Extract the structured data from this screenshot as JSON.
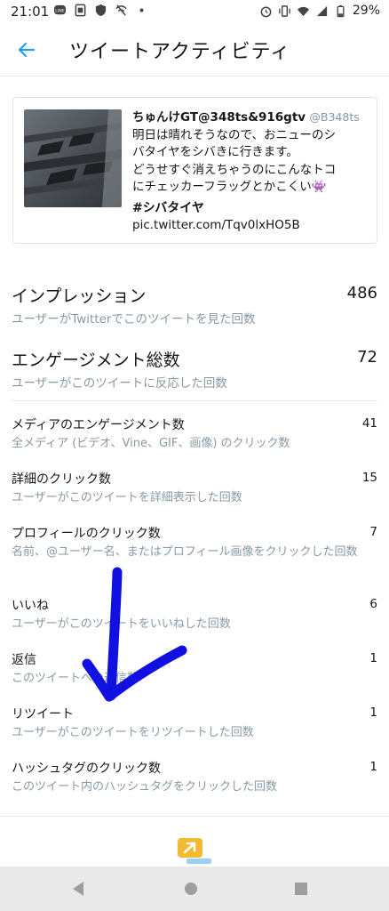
{
  "status_bar": {
    "time": "21:01",
    "battery": "29%"
  },
  "header": {
    "title": "ツイートアクティビティ"
  },
  "tweet": {
    "author": "ちゅんけGT@348ts&916gtv",
    "handle": "@B348ts",
    "text_line1": "明日は晴れそうなので、おニューのシ",
    "text_line2": "バタイヤをシバきに行きます。",
    "text_line3": "どうせすぐ消えちゃうのにこんなトコ",
    "text_line4": "にチェッカーフラッグとかこくい",
    "emoji": "👾",
    "hashtag": "#シバタイヤ",
    "link": "pic.twitter.com/Tqv0lxHO5B"
  },
  "metrics": [
    {
      "label": "インプレッション",
      "value": "486",
      "desc": "ユーザーがTwitterでこのツイートを見た回数"
    },
    {
      "label": "エンゲージメント総数",
      "value": "72",
      "desc": "ユーザーがこのツイートに反応した回数"
    },
    {
      "label": "メディアのエンゲージメント数",
      "value": "41",
      "desc": "全メディア (ビデオ、Vine、GIF、画像) のクリック数"
    },
    {
      "label": "詳細のクリック数",
      "value": "15",
      "desc": "ユーザーがこのツイートを詳細表示した回数"
    },
    {
      "label": "プロフィールのクリック数",
      "value": "7",
      "desc": "名前、@ユーザー名、またはプロフィール画像をクリックした回数"
    },
    {
      "label": "いいね",
      "value": "6",
      "desc": "ユーザーがこのツイートをいいねした回数"
    },
    {
      "label": "返信",
      "value": "1",
      "desc": "このツイートへの返信数"
    },
    {
      "label": "リツイート",
      "value": "1",
      "desc": "ユーザーがこのツイートをリツイートした回数"
    },
    {
      "label": "ハッシュタグのクリック数",
      "value": "1",
      "desc": "このツイート内のハッシュタグをクリックした回数"
    }
  ],
  "colors": {
    "accent": "#1da1f2",
    "secondary_text": "#8899a6",
    "annotation_arrow": "#1010e0",
    "promote_icon": "#f5b931"
  }
}
